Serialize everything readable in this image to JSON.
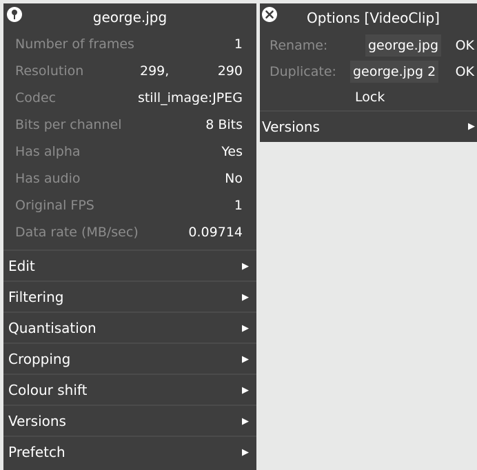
{
  "clip_panel": {
    "title": "george.jpg",
    "info": [
      {
        "label": "Number of frames",
        "value": "1"
      },
      {
        "label": "Codec",
        "value": "still_image:JPEG"
      },
      {
        "label": "Bits per channel",
        "value": "8 Bits"
      },
      {
        "label": "Has alpha",
        "value": "Yes"
      },
      {
        "label": "Has audio",
        "value": "No"
      },
      {
        "label": "Original FPS",
        "value": "1"
      },
      {
        "label": "Data rate (MB/sec)",
        "value": "0.09714"
      }
    ],
    "resolution": {
      "label": "Resolution",
      "width": "299,",
      "height": "290"
    },
    "sections": [
      {
        "label": "Edit"
      },
      {
        "label": "Filtering"
      },
      {
        "label": "Quantisation"
      },
      {
        "label": "Cropping"
      },
      {
        "label": "Colour shift"
      },
      {
        "label": "Versions"
      },
      {
        "label": "Prefetch"
      }
    ],
    "arrow_glyph": "▶"
  },
  "options_panel": {
    "title": "Options [VideoClip]",
    "rename": {
      "label": "Rename:",
      "value": "george.jpg",
      "ok": "OK"
    },
    "duplicate": {
      "label": "Duplicate:",
      "value": "george.jpg 2",
      "ok": "OK"
    },
    "lock_label": "Lock",
    "versions_label": "Versions",
    "arrow_glyph": "▶"
  },
  "icons": {
    "clip_panel_icon": "pin-icon",
    "options_panel_icon": "close-icon"
  },
  "colors": {
    "panel_bg": "#3e3e3e",
    "label_grey": "#8c8c8c",
    "page_bg": "#e8e9e8"
  }
}
